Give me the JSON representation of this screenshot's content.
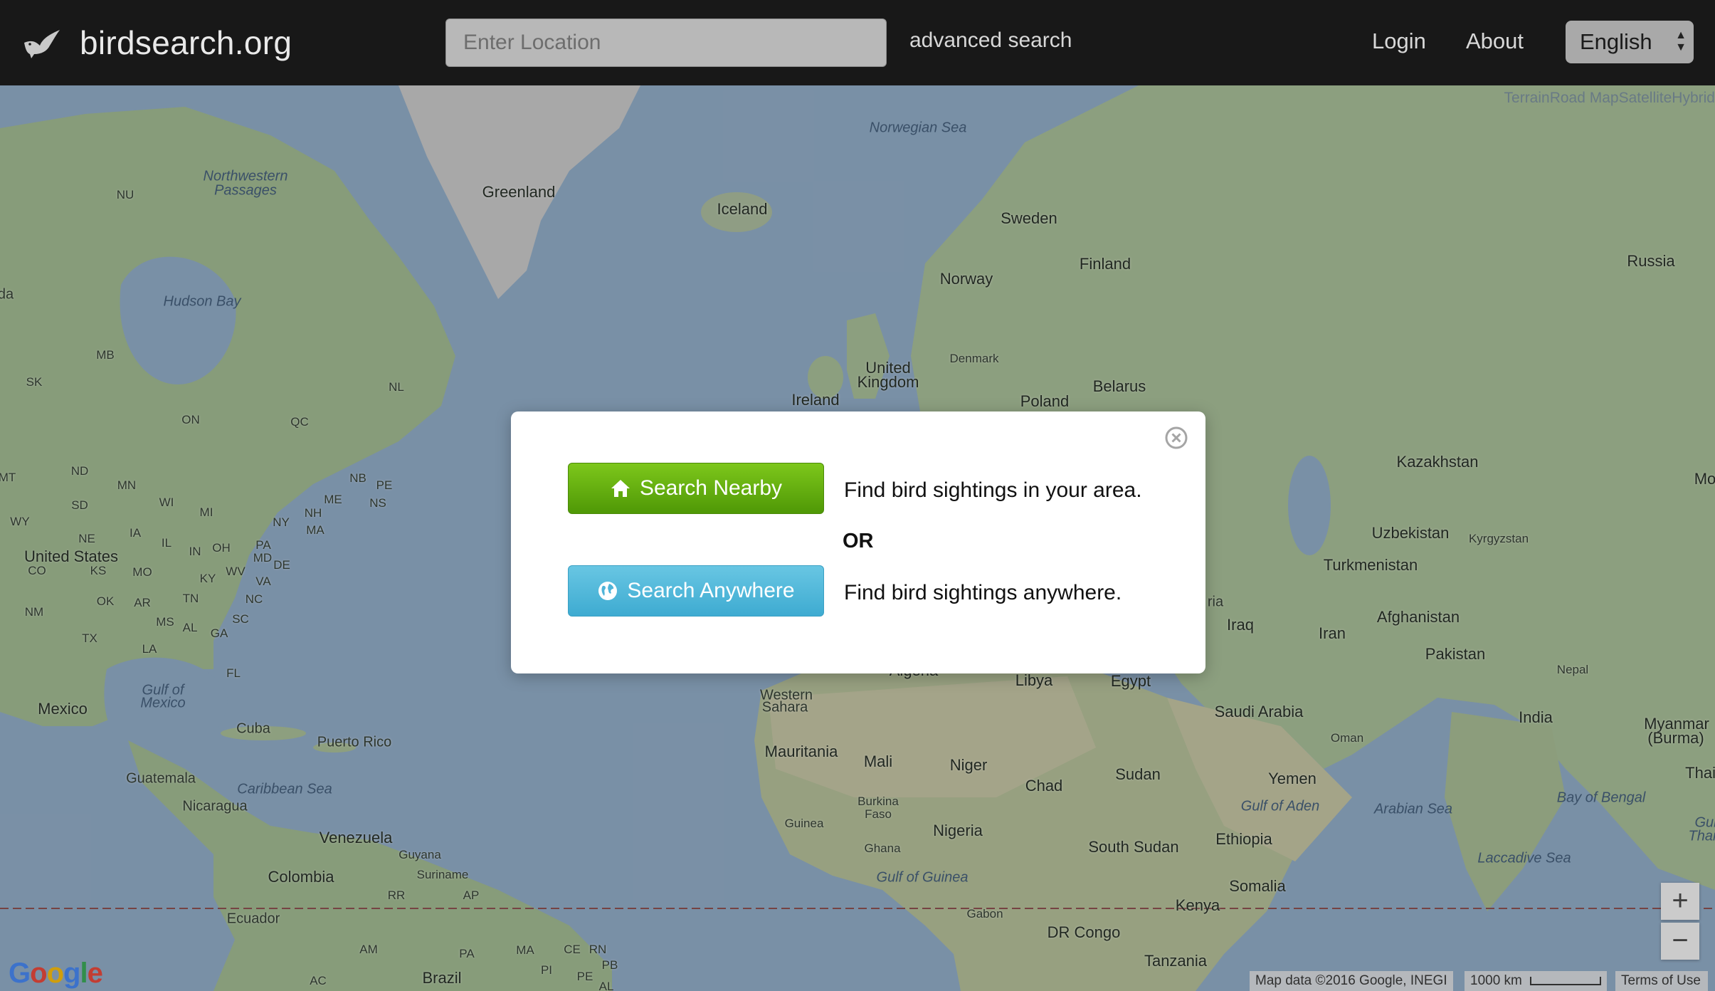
{
  "nav": {
    "brand": "birdsearch.org",
    "search_placeholder": "Enter Location",
    "advanced_search": "advanced search",
    "login": "Login",
    "about": "About",
    "language": "English"
  },
  "modal": {
    "nearby_button": "Search Nearby",
    "nearby_desc": "Find bird sightings in your area.",
    "or": "OR",
    "anywhere_button": "Search Anywhere",
    "anywhere_desc": "Find bird sightings anywhere."
  },
  "map": {
    "map_types": "TerrainRoad MapSatelliteHybrid",
    "attribution": "Map data ©2016 Google, INEGI",
    "scale": "1000 km",
    "terms": "Terms of Use",
    "zoom_in": "+",
    "zoom_out": "−",
    "labels": [
      {
        "text": "Northwestern",
        "type": "sea"
      },
      {
        "text": "Passages",
        "type": "sea"
      },
      {
        "text": "NU",
        "type": "small"
      },
      {
        "text": "Hudson Bay",
        "type": "sea"
      },
      {
        "text": "Greenland",
        "type": "big"
      },
      {
        "text": "Iceland",
        "type": "big"
      },
      {
        "text": "Norwegian Sea",
        "type": "sea"
      },
      {
        "text": "Sweden",
        "type": "big"
      },
      {
        "text": "Finland",
        "type": "big"
      },
      {
        "text": "Norway",
        "type": "big"
      },
      {
        "text": "Russia",
        "type": "big"
      },
      {
        "text": "United",
        "type": "big"
      },
      {
        "text": "Kingdom",
        "type": "big"
      },
      {
        "text": "Denmark",
        "type": "small"
      },
      {
        "text": "Ireland",
        "type": "big"
      },
      {
        "text": "Poland",
        "type": "big"
      },
      {
        "text": "Belarus",
        "type": "big"
      },
      {
        "text": "MB",
        "type": "small"
      },
      {
        "text": "SK",
        "type": "small"
      },
      {
        "text": "NL",
        "type": "small"
      },
      {
        "text": "ON",
        "type": "small"
      },
      {
        "text": "QC",
        "type": "small"
      },
      {
        "text": "MT",
        "type": "small"
      },
      {
        "text": "ND",
        "type": "small"
      },
      {
        "text": "MN",
        "type": "small"
      },
      {
        "text": "NB",
        "type": "small"
      },
      {
        "text": "PE",
        "type": "small"
      },
      {
        "text": "NS",
        "type": "small"
      },
      {
        "text": "SD",
        "type": "small"
      },
      {
        "text": "WI",
        "type": "small"
      },
      {
        "text": "ME",
        "type": "small"
      },
      {
        "text": "WY",
        "type": "small"
      },
      {
        "text": "MI",
        "type": "small"
      },
      {
        "text": "NH",
        "type": "small"
      },
      {
        "text": "NY",
        "type": "small"
      },
      {
        "text": "MA",
        "type": "small"
      },
      {
        "text": "NE",
        "type": "small"
      },
      {
        "text": "IA",
        "type": "small"
      },
      {
        "text": "IL",
        "type": "small"
      },
      {
        "text": "IN",
        "type": "small"
      },
      {
        "text": "OH",
        "type": "small"
      },
      {
        "text": "PA",
        "type": "small"
      },
      {
        "text": "MD",
        "type": "small"
      },
      {
        "text": "DE",
        "type": "small"
      },
      {
        "text": "United States",
        "type": "big"
      },
      {
        "text": "CO",
        "type": "small"
      },
      {
        "text": "KS",
        "type": "small"
      },
      {
        "text": "MO",
        "type": "small"
      },
      {
        "text": "KY",
        "type": "small"
      },
      {
        "text": "WV",
        "type": "small"
      },
      {
        "text": "VA",
        "type": "small"
      },
      {
        "text": "OK",
        "type": "small"
      },
      {
        "text": "AR",
        "type": "small"
      },
      {
        "text": "TN",
        "type": "small"
      },
      {
        "text": "NC",
        "type": "small"
      },
      {
        "text": "NM",
        "type": "small"
      },
      {
        "text": "MS",
        "type": "small"
      },
      {
        "text": "AL",
        "type": "small"
      },
      {
        "text": "SC",
        "type": "small"
      },
      {
        "text": "GA",
        "type": "small"
      },
      {
        "text": "TX",
        "type": "small"
      },
      {
        "text": "LA",
        "type": "small"
      },
      {
        "text": "FL",
        "type": "small"
      },
      {
        "text": "Gulf of",
        "type": "sea"
      },
      {
        "text": "Mexico",
        "type": "sea"
      },
      {
        "text": "Mexico",
        "type": "big"
      },
      {
        "text": "Cuba",
        "type": "normal"
      },
      {
        "text": "Puerto Rico",
        "type": "normal"
      },
      {
        "text": "Guatemala",
        "type": "normal"
      },
      {
        "text": "Caribbean Sea",
        "type": "sea"
      },
      {
        "text": "Nicaragua",
        "type": "normal"
      },
      {
        "text": "Venezuela",
        "type": "big"
      },
      {
        "text": "Guyana",
        "type": "small"
      },
      {
        "text": "Suriname",
        "type": "small"
      },
      {
        "text": "Colombia",
        "type": "big"
      },
      {
        "text": "RR",
        "type": "small"
      },
      {
        "text": "AP",
        "type": "small"
      },
      {
        "text": "Ecuador",
        "type": "normal"
      },
      {
        "text": "AM",
        "type": "small"
      },
      {
        "text": "PA",
        "type": "small"
      },
      {
        "text": "MA",
        "type": "small"
      },
      {
        "text": "CE",
        "type": "small"
      },
      {
        "text": "RN",
        "type": "small"
      },
      {
        "text": "PB",
        "type": "small"
      },
      {
        "text": "PI",
        "type": "small"
      },
      {
        "text": "PE",
        "type": "small"
      },
      {
        "text": "AC",
        "type": "small"
      },
      {
        "text": "Brazil",
        "type": "big"
      },
      {
        "text": "AL",
        "type": "small"
      },
      {
        "text": "Kazakhstan",
        "type": "big"
      },
      {
        "text": "Mo",
        "type": "big"
      },
      {
        "text": "Uzbekistan",
        "type": "big"
      },
      {
        "text": "Kyrgyzstan",
        "type": "small"
      },
      {
        "text": "Turkmenistan",
        "type": "big"
      },
      {
        "text": "ria",
        "type": "normal"
      },
      {
        "text": "Iraq",
        "type": "big"
      },
      {
        "text": "Iran",
        "type": "big"
      },
      {
        "text": "Afghanistan",
        "type": "big"
      },
      {
        "text": "Pakistan",
        "type": "big"
      },
      {
        "text": "Nepal",
        "type": "small"
      },
      {
        "text": "Algeria",
        "type": "big"
      },
      {
        "text": "Libya",
        "type": "big"
      },
      {
        "text": "Egypt",
        "type": "big"
      },
      {
        "text": "Western",
        "type": "normal"
      },
      {
        "text": "Sahara",
        "type": "normal"
      },
      {
        "text": "Saudi Arabia",
        "type": "big"
      },
      {
        "text": "Oman",
        "type": "small"
      },
      {
        "text": "India",
        "type": "big"
      },
      {
        "text": "Myanmar",
        "type": "big"
      },
      {
        "text": "(Burma)",
        "type": "big"
      },
      {
        "text": "Mauritania",
        "type": "big"
      },
      {
        "text": "Mali",
        "type": "big"
      },
      {
        "text": "Niger",
        "type": "big"
      },
      {
        "text": "Chad",
        "type": "big"
      },
      {
        "text": "Sudan",
        "type": "big"
      },
      {
        "text": "Yemen",
        "type": "big"
      },
      {
        "text": "Thail",
        "type": "big"
      },
      {
        "text": "Gulf of Aden",
        "type": "sea"
      },
      {
        "text": "Arabian Sea",
        "type": "sea"
      },
      {
        "text": "Bay of Bengal",
        "type": "sea"
      },
      {
        "text": "Guinea",
        "type": "small"
      },
      {
        "text": "Burkina",
        "type": "small"
      },
      {
        "text": "Faso",
        "type": "small"
      },
      {
        "text": "Nigeria",
        "type": "big"
      },
      {
        "text": "Ghana",
        "type": "small"
      },
      {
        "text": "Ethiopia",
        "type": "big"
      },
      {
        "text": "South Sudan",
        "type": "big"
      },
      {
        "text": "Gul",
        "type": "sea"
      },
      {
        "text": "Thai",
        "type": "sea"
      },
      {
        "text": "Laccadive Sea",
        "type": "sea"
      },
      {
        "text": "Gulf of Guinea",
        "type": "sea"
      },
      {
        "text": "Somalia",
        "type": "big"
      },
      {
        "text": "Gabon",
        "type": "small"
      },
      {
        "text": "Kenya",
        "type": "big"
      },
      {
        "text": "DR Congo",
        "type": "big"
      },
      {
        "text": "Tanzania",
        "type": "big"
      },
      {
        "text": "da",
        "type": "normal"
      }
    ]
  }
}
